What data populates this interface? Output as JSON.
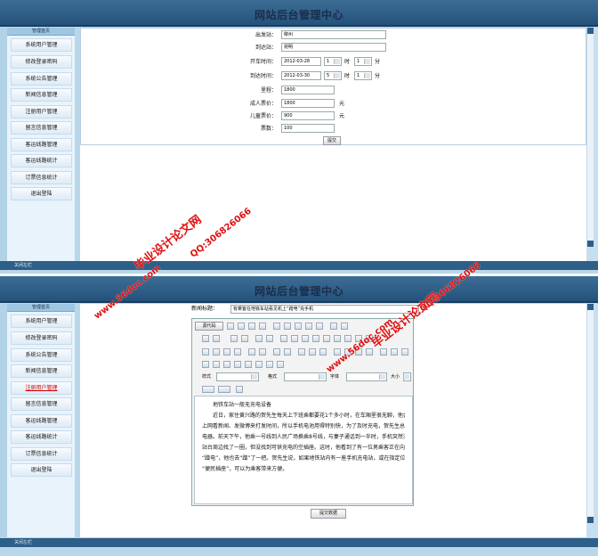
{
  "app_title": "网站后台管理中心",
  "nav_head": "管理首页",
  "nav_items": [
    "系统用户管理",
    "修改登录密码",
    "系统公告管理",
    "新闻信息管理",
    "注册用户管理",
    "留言信息管理",
    "客运线路管理",
    "客运线路统计",
    "订票信息统计",
    "退出登陆"
  ],
  "footer": "关闭左栏",
  "form": {
    "departure_label": "出发站：",
    "departure_value": "柳州",
    "arrival_label": "到达站：",
    "arrival_value": "昆明",
    "depart_time_label": "开车时间：",
    "depart_date": "2012-03-28",
    "depart_hour": "1",
    "depart_min": "1",
    "arrive_time_label": "到达时间：",
    "arrive_date": "2012-03-30",
    "arrive_hour": "5",
    "arrive_min": "1",
    "hour_unit": "时",
    "min_unit": "分",
    "distance_label": "里程：",
    "distance_value": "1800",
    "adult_label": "成人票价：",
    "adult_value": "1800",
    "child_label": "儿童票价：",
    "child_value": "900",
    "yuan": "元",
    "tickets_label": "票数：",
    "tickets_value": "100",
    "submit": "提交"
  },
  "news": {
    "title_label": "新闻标题：",
    "title_value": "有乘客在地铁车站看见机上“蹭电”充手机",
    "source_btn": "源代码",
    "style_label": "样式",
    "format_label": "格式",
    "font_label": "字体",
    "size_label": "大小",
    "body": [
      "地铁车站一般无充电设备",
      "近日，家住黄兴路的贺先生每天上下班乘都要花1个多小时，在车厢里很无聊，他会选择",
      "上网看新闻、发微博来打发时间，所以手机电池用得特别快，为了及时充电，贺先生总是随",
      "电器。前天下午，他乘一号线到人民广场换乘8号线，与妻子通话到一半时，手机突然没电了",
      "站台周边找了一圈，但没找到可供充电的空插座。这时，他看到了有一位男乘客正在向自助",
      "“蹭电”，他也去“蹭”了一把。贺先生说，如果地铁站内有一座手机充电站，或在指定位",
      "“便民插座”，可以为乘客带来方便。"
    ],
    "submit": "提交数据"
  },
  "watermarks": [
    "毕业设计论文网",
    "www.56doc.com",
    "QQ:306826066"
  ]
}
